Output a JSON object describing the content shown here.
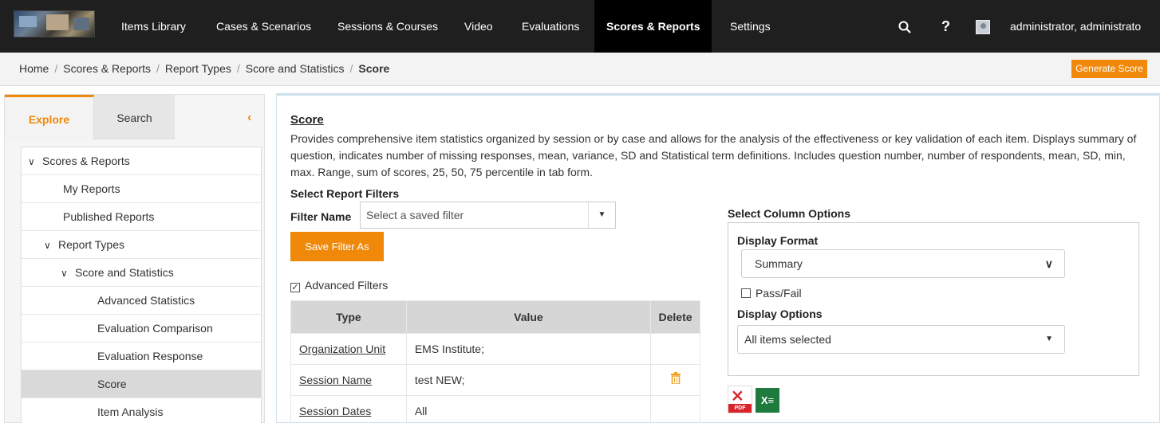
{
  "nav": {
    "items": [
      "Items Library",
      "Cases & Scenarios",
      "Sessions & Courses",
      "Video",
      "Evaluations",
      "Scores & Reports",
      "Settings"
    ],
    "search_icon": "search-icon",
    "help_label": "?",
    "username": "administrator, administrato"
  },
  "breadcrumb": {
    "items": [
      "Home",
      "Scores & Reports",
      "Report Types",
      "Score and Statistics"
    ],
    "current": "Score"
  },
  "generate_button": "Generate Score",
  "left_panel": {
    "tabs": [
      "Explore",
      "Search"
    ],
    "tree": [
      "Scores & Reports",
      "My Reports",
      "Published Reports",
      "Report Types",
      "Score and Statistics",
      "Advanced Statistics",
      "Evaluation Comparison",
      "Evaluation Response",
      "Score",
      "Item Analysis"
    ]
  },
  "main": {
    "title": "Score",
    "description": "Provides comprehensive item statistics organized by session or by case and allows for the analysis of the effectiveness or key validation of each item. Displays summary of question, indicates number of missing responses, mean, variance, SD and Statistical term definitions. Includes question number, number of respondents, mean, SD, min, max. Range, sum of scores, 25, 50, 75 percentile in tab form.",
    "select_filters_label": "Select Report Filters",
    "filter_name_label": "Filter Name",
    "filter_placeholder": "Select a saved filter",
    "save_filter_button": "Save Filter As",
    "advanced_filters_label": "Advanced Filters",
    "table": {
      "headers": [
        "Type",
        "Value",
        "Delete"
      ],
      "rows": [
        [
          "Organization Unit",
          "EMS Institute;"
        ],
        [
          "Session Name",
          "test NEW;"
        ],
        [
          "Session Dates",
          "All"
        ]
      ]
    },
    "column_options": {
      "label": "Select Column Options",
      "display_format_label": "Display Format",
      "display_format_value": "Summary",
      "pass_fail_label": "Pass/Fail",
      "display_options_label": "Display Options",
      "display_options_value": "All items selected"
    },
    "export": {
      "pdf_label": "PDF",
      "excel_label": "X"
    }
  },
  "colors": {
    "accent": "#f0880a",
    "nav_bg": "#1f1f1f",
    "pdf_red": "#d8232a",
    "excel_green": "#1f7a3e"
  }
}
